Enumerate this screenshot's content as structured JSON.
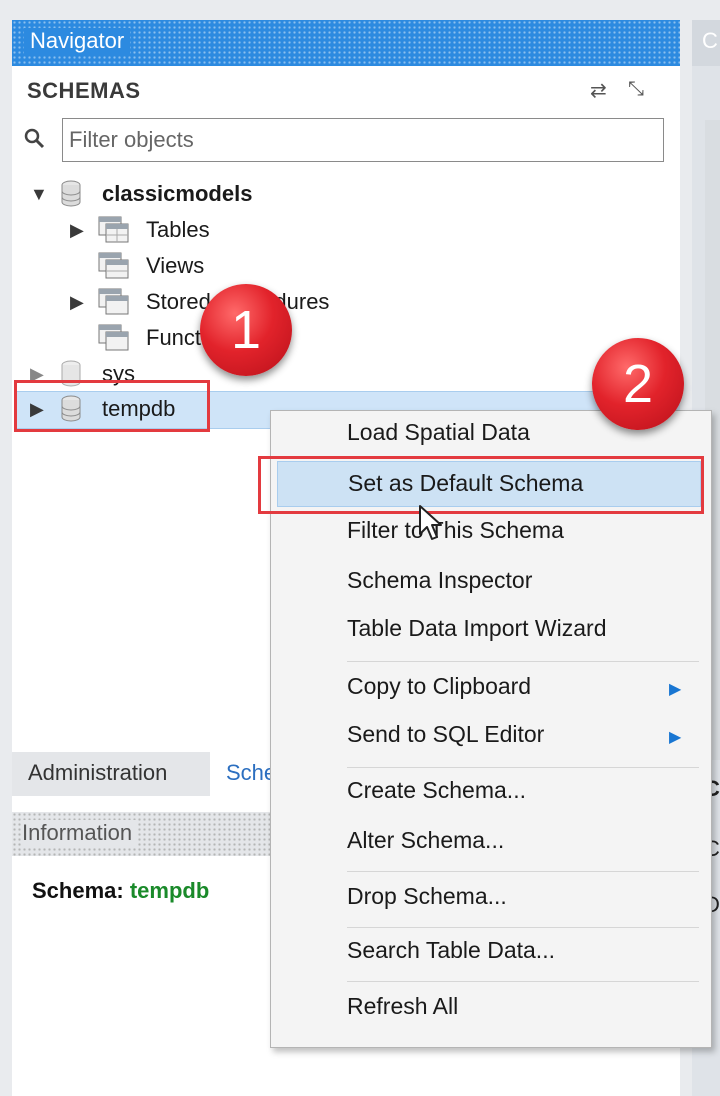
{
  "navigator": {
    "title": "Navigator",
    "schemas_title": "SCHEMAS",
    "filter_placeholder": "Filter objects"
  },
  "tree": {
    "db1": {
      "name": "classicmodels"
    },
    "children": {
      "tables": "Tables",
      "views": "Views",
      "stored": "Stored Procedures",
      "functions": "Functions"
    },
    "db2": {
      "name": "sys"
    },
    "db3": {
      "name": "tempdb"
    }
  },
  "badges": {
    "one": "1",
    "two": "2"
  },
  "context_menu": {
    "items": [
      "Load Spatial Data",
      "Set as Default Schema",
      "Filter to This Schema",
      "Schema Inspector",
      "Table Data Import Wizard",
      "Copy to Clipboard",
      "Send to SQL Editor",
      "Create Schema...",
      "Alter Schema...",
      "Drop Schema...",
      "Search Table Data...",
      "Refresh All"
    ]
  },
  "bottom_tabs": {
    "administration": "Administration",
    "schemas": "Schemas"
  },
  "info": {
    "title": "Information",
    "schema_label": "Schema:",
    "schema_value": "tempdb"
  },
  "right_panel": {
    "frag_top": "C",
    "frag1": "C",
    "frag2": "C",
    "frag3": "D"
  },
  "colors": {
    "accent": "#2c8ae0",
    "highlight_box": "#e33a3f",
    "schema_value": "#1a8a2a"
  }
}
